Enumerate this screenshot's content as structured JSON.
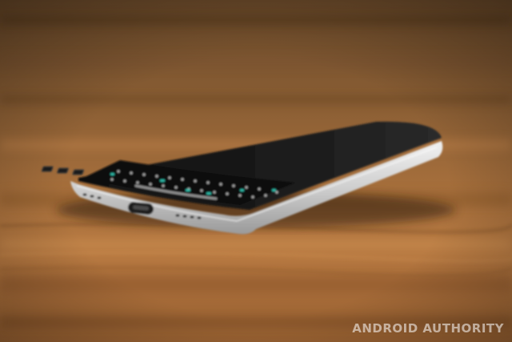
{
  "photo": {
    "subject": "smartphone-with-physical-keyboard-on-wooden-table",
    "watermark": "ANDROID AUTHORITY",
    "colors": {
      "wood_dark": "#5a3a1c",
      "wood_mid": "#a66f3c",
      "wood_light": "#c98a4c",
      "phone_frame": "#d9d9d9",
      "phone_body": "#141414",
      "key_accent": "#2fb7a6"
    }
  }
}
